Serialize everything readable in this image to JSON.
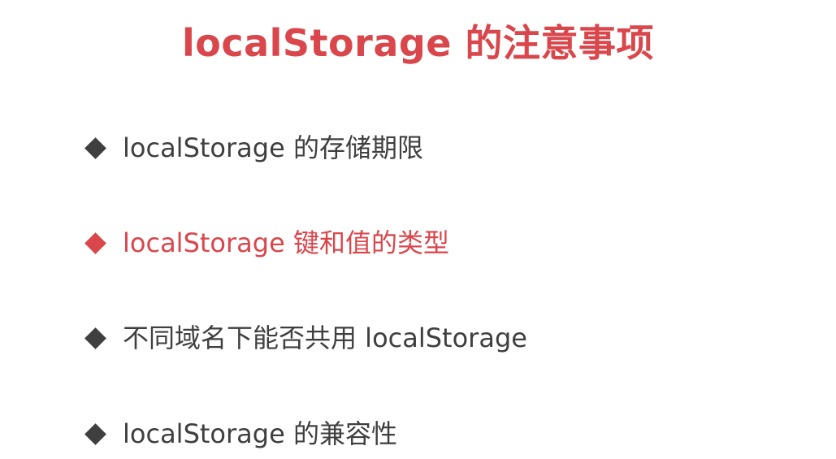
{
  "colors": {
    "accent": "#d9464b",
    "text": "#3f3f3f",
    "background": "#ffffff"
  },
  "slide": {
    "title": "localStorage 的注意事项",
    "items": [
      {
        "text": "localStorage 的存储期限",
        "bullet_icon": "diamond-bullet-icon",
        "highlighted": false
      },
      {
        "text": "localStorage 键和值的类型",
        "bullet_icon": "diamond-bullet-icon",
        "highlighted": true
      },
      {
        "text": "不同域名下能否共用 localStorage",
        "bullet_icon": "diamond-bullet-icon",
        "highlighted": false
      },
      {
        "text": "localStorage 的兼容性",
        "bullet_icon": "diamond-bullet-icon",
        "highlighted": false
      }
    ]
  }
}
